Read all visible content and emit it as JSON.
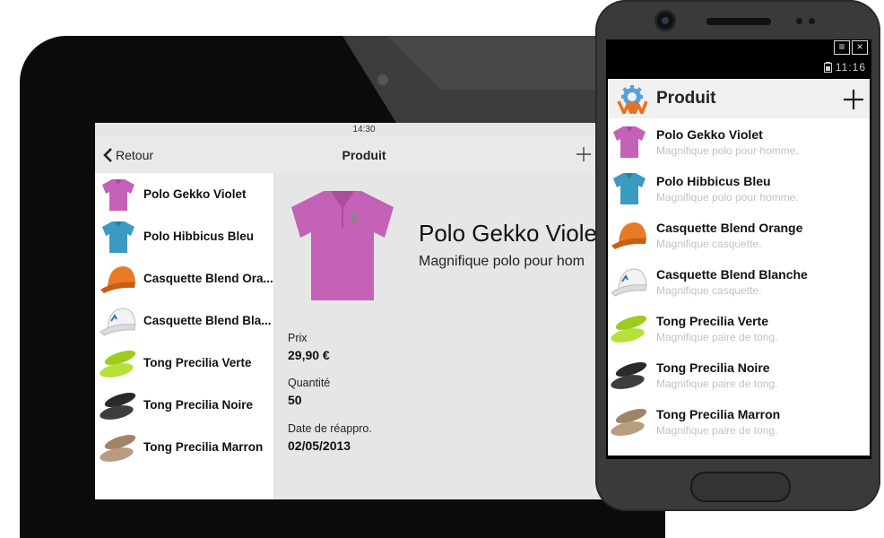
{
  "tablet": {
    "status_time": "14:30",
    "back_label": "Retour",
    "title": "Produit",
    "list": [
      {
        "label": "Polo Gekko Violet",
        "icon": "polo-violet-icon"
      },
      {
        "label": "Polo Hibbicus Bleu",
        "icon": "polo-blue-icon"
      },
      {
        "label": "Casquette Blend Ora...",
        "icon": "cap-orange-icon"
      },
      {
        "label": "Casquette Blend Bla...",
        "icon": "cap-white-icon"
      },
      {
        "label": "Tong Precilia Verte",
        "icon": "flipflop-green-icon"
      },
      {
        "label": "Tong Precilia Noire",
        "icon": "flipflop-black-icon"
      },
      {
        "label": "Tong Precilia Marron",
        "icon": "flipflop-brown-icon"
      }
    ],
    "detail": {
      "name": "Polo Gekko Viole",
      "description": "Magnifique polo pour hom",
      "price_label": "Prix",
      "price": "29,90 €",
      "qty_label": "Quantité",
      "qty": "50",
      "date_label": "Date de réappro.",
      "date": "02/05/2013"
    }
  },
  "phone": {
    "time": "11:16",
    "title": "Produit",
    "list": [
      {
        "label": "Polo Gekko Violet",
        "desc": "Magnifique polo pour homme.",
        "icon": "polo-violet-icon"
      },
      {
        "label": "Polo Hibbicus Bleu",
        "desc": "Magnifique polo pour homme.",
        "icon": "polo-blue-icon"
      },
      {
        "label": "Casquette Blend Orange",
        "desc": "Magnifique casquette.",
        "icon": "cap-orange-icon"
      },
      {
        "label": "Casquette Blend Blanche",
        "desc": "Magnifique casquette.",
        "icon": "cap-white-icon"
      },
      {
        "label": "Tong Precilia Verte",
        "desc": "Magnifique paire de tong.",
        "icon": "flipflop-green-icon"
      },
      {
        "label": "Tong Precilia Noire",
        "desc": "Magnifique paire de tong.",
        "icon": "flipflop-black-icon"
      },
      {
        "label": "Tong Precilia Marron",
        "desc": "Magnifique paire de tong.",
        "icon": "flipflop-brown-icon"
      }
    ]
  },
  "colors": {
    "polo_violet": "#c362b6",
    "polo_blue": "#3a9ac0",
    "cap_orange": "#e87a26",
    "cap_white": "#f2f2f2",
    "tong_green": "#9ccc1e",
    "tong_black": "#2a2a2a",
    "tong_brown": "#a08468"
  }
}
